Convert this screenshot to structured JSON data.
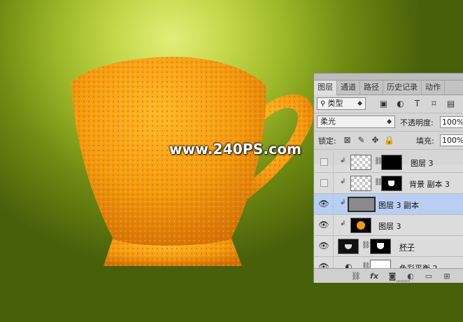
{
  "watermark": "www.240PS.com",
  "colors": {
    "background": "#9eb82a",
    "selected_row": "#b8cff3",
    "orange": "#f29a12"
  },
  "tabs": [
    "图层",
    "通道",
    "路径",
    "历史记录",
    "动作"
  ],
  "filter": {
    "label": "类型"
  },
  "blend_mode": "柔光",
  "opacity": {
    "label": "不透明度:",
    "value": "100%"
  },
  "lock": {
    "label": "锁定:"
  },
  "fill": {
    "label": "填充:",
    "value": "100%"
  },
  "layers": [
    {
      "name": "图层 3",
      "visible": false,
      "clipped": true,
      "selected": false
    },
    {
      "name": "背景 副本 3",
      "visible": false,
      "clipped": true,
      "selected": false
    },
    {
      "name": "图层 3 副本",
      "visible": true,
      "clipped": true,
      "selected": true
    },
    {
      "name": "图层 3",
      "visible": true,
      "clipped": true,
      "selected": false
    },
    {
      "name": "杯子",
      "visible": true,
      "clipped": false,
      "selected": false
    },
    {
      "name": "色彩平衡 2",
      "visible": true,
      "clipped": false,
      "selected": false
    }
  ],
  "icons": {
    "filter": [
      "image-filter-icon",
      "adjustment-filter-icon",
      "type-filter-icon",
      "shape-filter-icon",
      "smart-object-filter-icon"
    ],
    "lock": [
      "lock-transparent-icon",
      "lock-image-icon",
      "lock-position-icon",
      "lock-all-icon"
    ],
    "bottom": [
      "link-layers-icon",
      "fx-icon",
      "add-mask-icon",
      "new-adjustment-icon",
      "new-group-icon",
      "new-layer-icon"
    ]
  }
}
